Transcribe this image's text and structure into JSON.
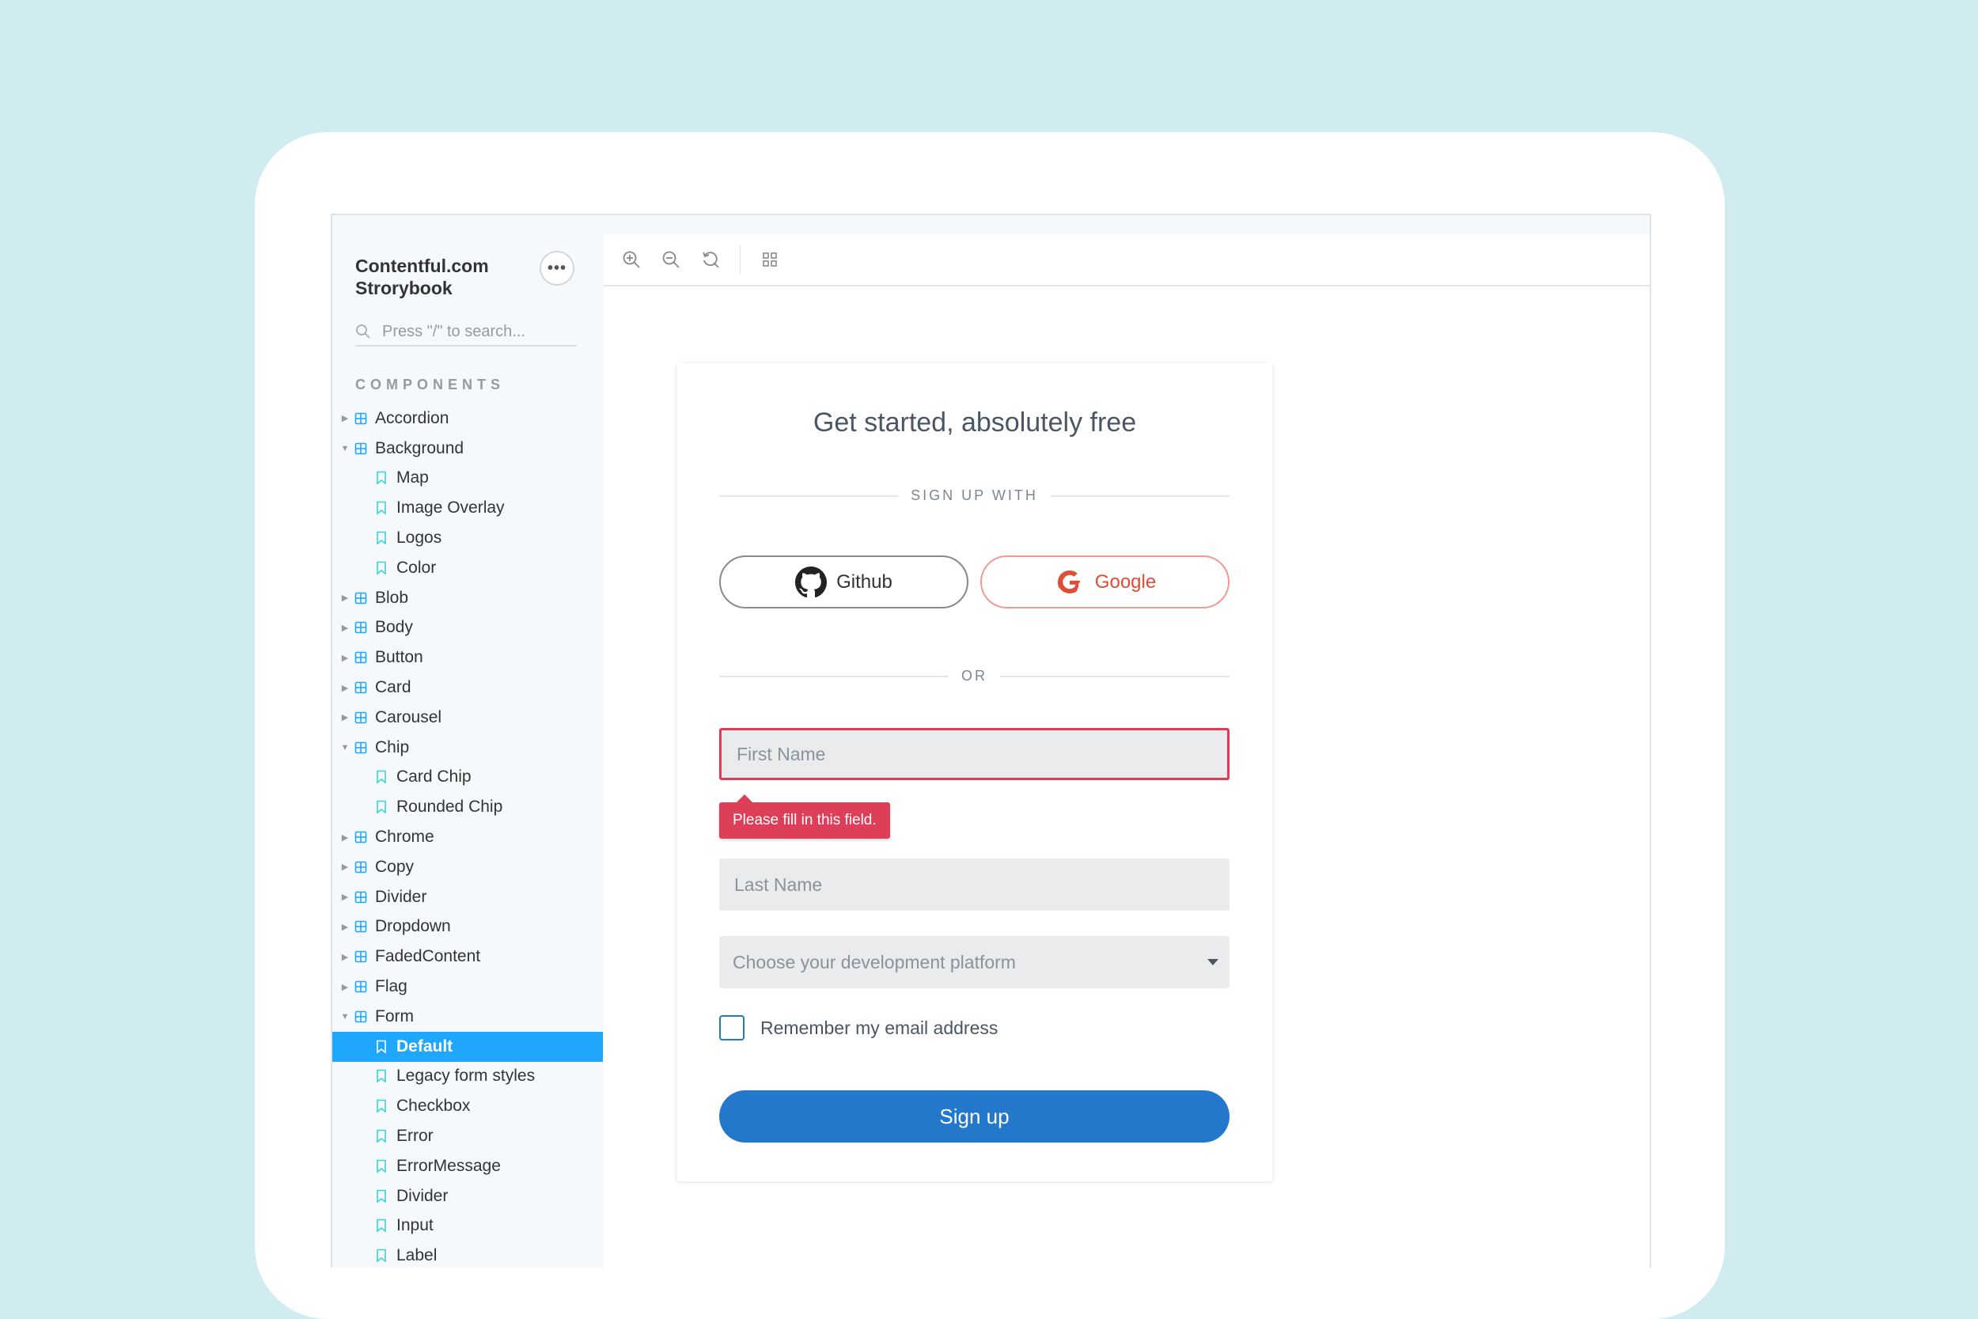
{
  "sidebar": {
    "brand": "Contentful.com Strorybook",
    "more_label": "•••",
    "search_placeholder": "Press \"/\" to search...",
    "section_title": "COMPONENTS",
    "items": [
      {
        "label": "Accordion",
        "type": "component",
        "expanded": false
      },
      {
        "label": "Background",
        "type": "component",
        "expanded": true
      },
      {
        "label": "Map",
        "type": "story"
      },
      {
        "label": "Image Overlay",
        "type": "story"
      },
      {
        "label": "Logos",
        "type": "story"
      },
      {
        "label": "Color",
        "type": "story"
      },
      {
        "label": "Blob",
        "type": "component",
        "expanded": false
      },
      {
        "label": "Body",
        "type": "component",
        "expanded": false
      },
      {
        "label": "Button",
        "type": "component",
        "expanded": false
      },
      {
        "label": "Card",
        "type": "component",
        "expanded": false
      },
      {
        "label": "Carousel",
        "type": "component",
        "expanded": false
      },
      {
        "label": "Chip",
        "type": "component",
        "expanded": true
      },
      {
        "label": "Card Chip",
        "type": "story"
      },
      {
        "label": "Rounded Chip",
        "type": "story"
      },
      {
        "label": "Chrome",
        "type": "component",
        "expanded": false
      },
      {
        "label": "Copy",
        "type": "component",
        "expanded": false
      },
      {
        "label": "Divider",
        "type": "component",
        "expanded": false
      },
      {
        "label": "Dropdown",
        "type": "component",
        "expanded": false
      },
      {
        "label": "FadedContent",
        "type": "component",
        "expanded": false
      },
      {
        "label": "Flag",
        "type": "component",
        "expanded": false
      },
      {
        "label": "Form",
        "type": "component",
        "expanded": true
      },
      {
        "label": "Default",
        "type": "story",
        "selected": true
      },
      {
        "label": "Legacy form styles",
        "type": "story"
      },
      {
        "label": "Checkbox",
        "type": "story"
      },
      {
        "label": "Error",
        "type": "story"
      },
      {
        "label": "ErrorMessage",
        "type": "story"
      },
      {
        "label": "Divider",
        "type": "story"
      },
      {
        "label": "Input",
        "type": "story"
      },
      {
        "label": "Label",
        "type": "story"
      }
    ]
  },
  "toolbar": {
    "icons": [
      "zoom-in-icon",
      "zoom-out-icon",
      "reset-zoom-icon",
      "grid-icon"
    ]
  },
  "form": {
    "title": "Get started, absolutely free",
    "sign_up_with": "SIGN UP WITH",
    "github_label": "Github",
    "google_label": "Google",
    "or_label": "OR",
    "first_name_placeholder": "First Name",
    "error_tooltip": "Please fill in this field.",
    "last_name_placeholder": "Last Name",
    "platform_placeholder": "Choose your development platform",
    "remember_label": "Remember my email address",
    "submit_label": "Sign up"
  },
  "colors": {
    "background": "#d0ecf0",
    "sidebar_selected": "#1ea7fd",
    "story_icon": "#37d5d3",
    "component_icon": "#1ea7fd",
    "primary_button": "#2478cc",
    "error": "#dd3f58",
    "google": "#e04c35"
  }
}
